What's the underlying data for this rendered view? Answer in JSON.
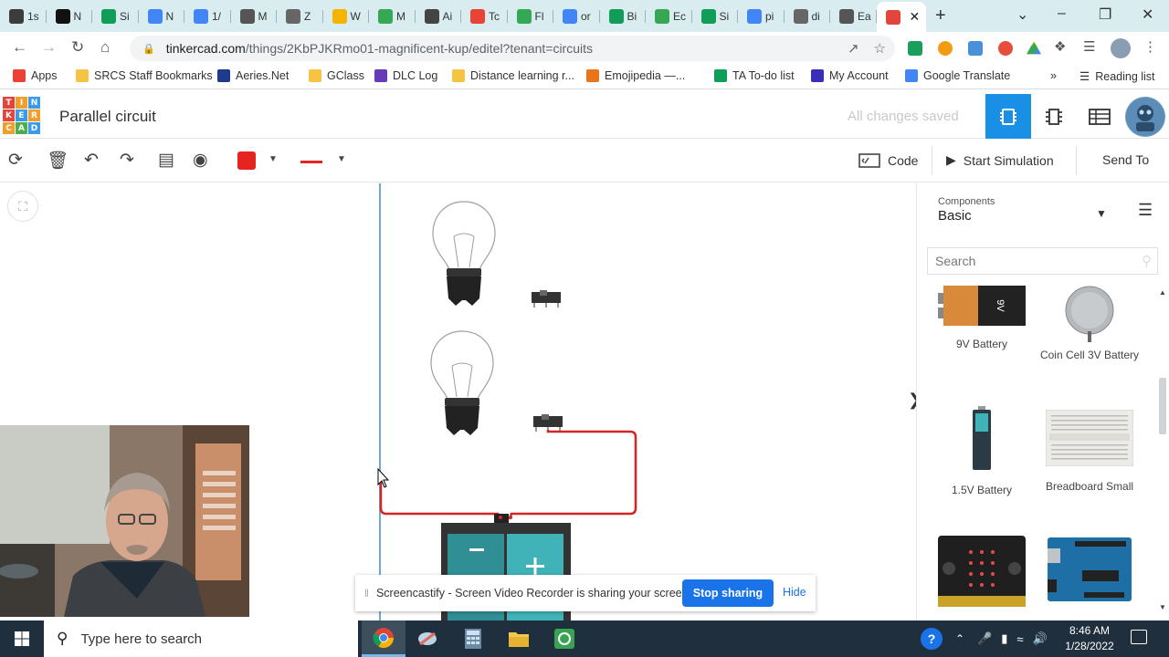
{
  "browser": {
    "tabs": [
      {
        "label": "1s",
        "icon": "docs-dark-icon",
        "color": "#3c3c3c"
      },
      {
        "label": "N",
        "icon": "notion-icon",
        "color": "#111111"
      },
      {
        "label": "Si",
        "icon": "sheets-icon",
        "color": "#0f9d58"
      },
      {
        "label": "N",
        "icon": "docs-icon",
        "color": "#4285f4"
      },
      {
        "label": "1/",
        "icon": "docs-icon",
        "color": "#4285f4"
      },
      {
        "label": "M",
        "icon": "meet-icon",
        "color": "#555555"
      },
      {
        "label": "Z",
        "icon": "globe-icon",
        "color": "#666666"
      },
      {
        "label": "W",
        "icon": "slides-icon",
        "color": "#f4b400"
      },
      {
        "label": "M",
        "icon": "drive-icon",
        "color": "#34a853"
      },
      {
        "label": "Ai",
        "icon": "gear-icon",
        "color": "#444444"
      },
      {
        "label": "Tc",
        "icon": "gmail-icon",
        "color": "#ea4335"
      },
      {
        "label": "Fl",
        "icon": "plus-circle-icon",
        "color": "#34a853"
      },
      {
        "label": "or",
        "icon": "google-icon",
        "color": "#4285f4"
      },
      {
        "label": "Bi",
        "icon": "sheets-icon",
        "color": "#0f9d58"
      },
      {
        "label": "Ec",
        "icon": "plus-circle-icon",
        "color": "#34a853"
      },
      {
        "label": "Si",
        "icon": "sheets-icon",
        "color": "#0f9d58"
      },
      {
        "label": "pi",
        "icon": "google-icon",
        "color": "#4285f4"
      },
      {
        "label": "di",
        "icon": "globe-icon",
        "color": "#666666"
      },
      {
        "label": "Ea",
        "icon": "classroom-icon",
        "color": "#555555"
      },
      {
        "label": "",
        "icon": "tinkercad-icon",
        "color": "#e2453c",
        "active": true
      }
    ],
    "url_main": "tinkercad.com",
    "url_path": "/things/2KbPJKRmo01-magnificent-kup/editel?tenant=circuits",
    "bookmarks": [
      {
        "label": "Apps",
        "icon": "apps-grid-icon",
        "color": "#ea4335"
      },
      {
        "label": "SRCS Staff Bookmarks",
        "icon": "folder-icon",
        "color": "#f6c343"
      },
      {
        "label": "Aeries.Net",
        "icon": "aeries-icon",
        "color": "#1e3a8a"
      },
      {
        "label": "GClass",
        "icon": "folder-icon",
        "color": "#f6c343"
      },
      {
        "label": "DLC Log",
        "icon": "forms-icon",
        "color": "#673ab7"
      },
      {
        "label": "Distance learning r...",
        "icon": "folder-icon",
        "color": "#f6c343"
      },
      {
        "label": "Emojipedia —...",
        "icon": "emojipedia-icon",
        "color": "#e8741b"
      },
      {
        "label": "TA To-do list",
        "icon": "sheets-icon",
        "color": "#0f9d58"
      },
      {
        "label": "My Account",
        "icon": "account-icon",
        "color": "#3b2db5"
      },
      {
        "label": "Google Translate",
        "icon": "translate-icon",
        "color": "#4285f4"
      }
    ],
    "reading_list": "Reading list",
    "more_bookmarks": "»"
  },
  "tinkercad": {
    "logo_letters": [
      "T",
      "I",
      "N",
      "K",
      "E",
      "R",
      "C",
      "A",
      "D"
    ],
    "logo_colors": [
      "#e2453c",
      "#f0a02a",
      "#3b9be8",
      "#e2453c",
      "#3b9be8",
      "#f0a02a",
      "#f0a02a",
      "#4cae4c",
      "#3b9be8"
    ],
    "project_title": "Parallel circuit",
    "save_status": "All changes saved",
    "accent": "#1a8fe6",
    "toolbar": {
      "color_swatch": "#e52420",
      "code_label": "Code",
      "start_label": "Start Simulation",
      "send_label": "Send To"
    },
    "panel": {
      "components_label": "Components",
      "selected_category": "Basic",
      "search_placeholder": "Search",
      "items": [
        {
          "label": "9V Battery",
          "icon": "9v-battery-icon"
        },
        {
          "label": "Coin Cell 3V Battery",
          "icon": "coin-cell-icon"
        },
        {
          "label": "1.5V Battery",
          "icon": "aa-battery-icon"
        },
        {
          "label": "Breadboard Small",
          "icon": "breadboard-icon"
        },
        {
          "label": "",
          "icon": "microbit-icon"
        },
        {
          "label": "",
          "icon": "arduino-uno-icon"
        }
      ],
      "battery_text": "9V"
    }
  },
  "screencast": {
    "message": "Screencastify - Screen Video Recorder is sharing your screen.",
    "stop_label": "Stop sharing",
    "hide_label": "Hide"
  },
  "taskbar": {
    "search_placeholder": "Type here to search",
    "time": "8:46 AM",
    "date": "1/28/2022"
  }
}
